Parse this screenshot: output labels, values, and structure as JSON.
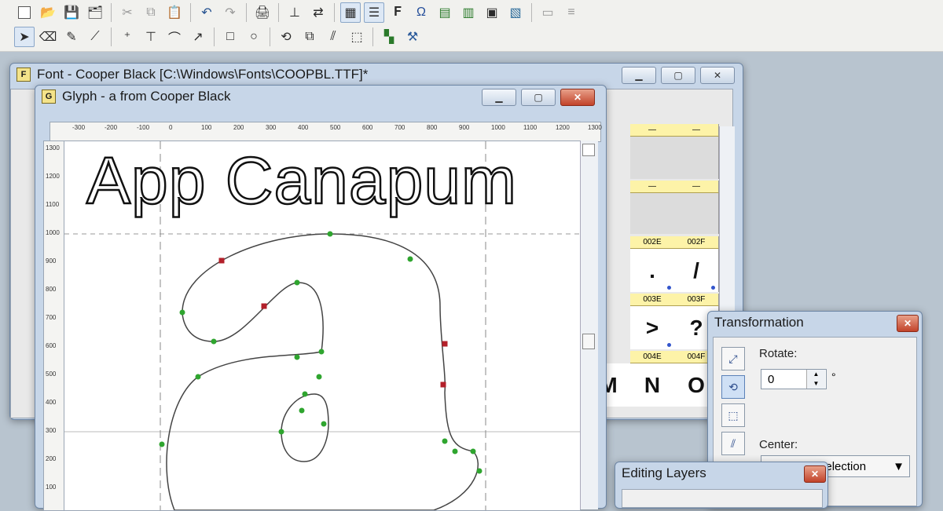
{
  "toolbar": {
    "row1_icons": [
      "new-icon",
      "open-icon",
      "save-icon",
      "save-all-icon",
      "cut-icon",
      "copy-icon",
      "paste-icon",
      "undo-icon",
      "redo-icon",
      "print-icon",
      "metrics-icon",
      "view-icon",
      "grid-icon",
      "list-icon",
      "font-icon",
      "preview-icon",
      "chart-icon",
      "table-icon",
      "export-icon",
      "settings-icon"
    ],
    "row2_icons": [
      "pointer-icon",
      "eraser-icon",
      "pen-icon",
      "knife-icon",
      "add-node-icon",
      "add-corner-icon",
      "add-curve-icon",
      "add-tangent-icon",
      "rectangle-icon",
      "ellipse-icon",
      "rotate-icon",
      "scale-icon",
      "slant-icon",
      "transform-icon",
      "layers-icon",
      "measure-icon"
    ]
  },
  "font_window": {
    "badge": "F",
    "title": "Font - Cooper Black [C:\\Windows\\Fonts\\COOPBL.TTF]*",
    "grid": {
      "row1_codes": [
        "—",
        "—"
      ],
      "row2_codes": [
        "002E",
        "002F"
      ],
      "row2_chars": [
        ".",
        "/"
      ],
      "row3_codes": [
        "003E",
        "003F"
      ],
      "row3_chars": [
        ">",
        "?"
      ],
      "row4_codes": [
        "004E",
        "004F"
      ],
      "row4_chars": [
        "N",
        "O"
      ],
      "partial_chars": [
        "M"
      ]
    }
  },
  "glyph_window": {
    "badge": "G",
    "title": "Glyph - a from Cooper Black",
    "ruler_h": [
      "-300",
      "-200",
      "-100",
      "0",
      "100",
      "200",
      "300",
      "400",
      "500",
      "600",
      "700",
      "800",
      "900",
      "1000",
      "1100",
      "1200",
      "1300"
    ],
    "ruler_v": [
      "1300",
      "1200",
      "1100",
      "1000",
      "900",
      "800",
      "700",
      "600",
      "500",
      "400",
      "300",
      "200",
      "100"
    ]
  },
  "overlay_title": "App Canapum",
  "transformation": {
    "title": "Transformation",
    "rotate_label": "Rotate:",
    "rotate_value": "0",
    "degree": "°",
    "center_label": "Center:",
    "center_value": "Center of selection"
  },
  "editing_layers": {
    "title": "Editing Layers"
  }
}
